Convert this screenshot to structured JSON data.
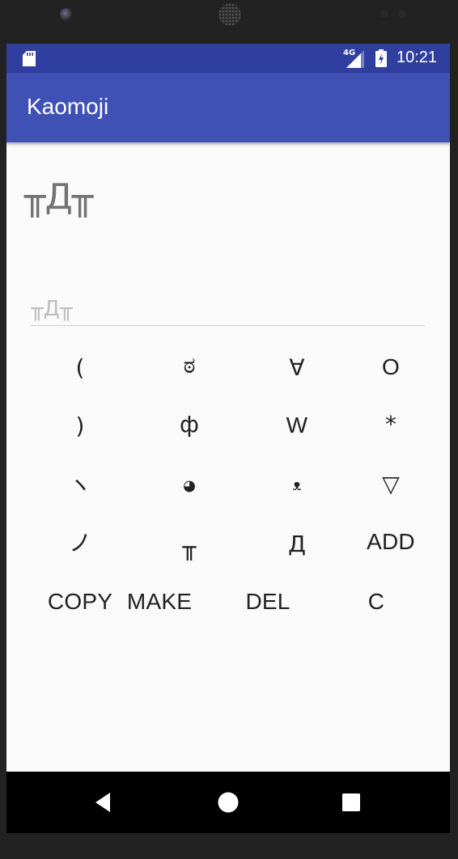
{
  "status_bar": {
    "network_label": "4G",
    "time": "10:21"
  },
  "app_bar": {
    "title": "Kaomoji"
  },
  "display": {
    "text": "╥Д╥"
  },
  "input": {
    "placeholder": "╥Д╥",
    "value": ""
  },
  "keypad": {
    "row1": [
      "(",
      "ಠ",
      "∀",
      "O"
    ],
    "row2": [
      ")",
      "ф",
      "W",
      "*"
    ],
    "row3": [
      "ヽ",
      "◕",
      "ᴥ",
      "▽"
    ],
    "row4": [
      "ノ",
      "╥",
      "Д",
      "ADD"
    ],
    "actions": [
      "COPY",
      "MAKE",
      "DEL",
      "C"
    ]
  },
  "nav_bar": {
    "back_icon": "triangle-back",
    "home_icon": "circle-home",
    "recents_icon": "square-recents"
  }
}
